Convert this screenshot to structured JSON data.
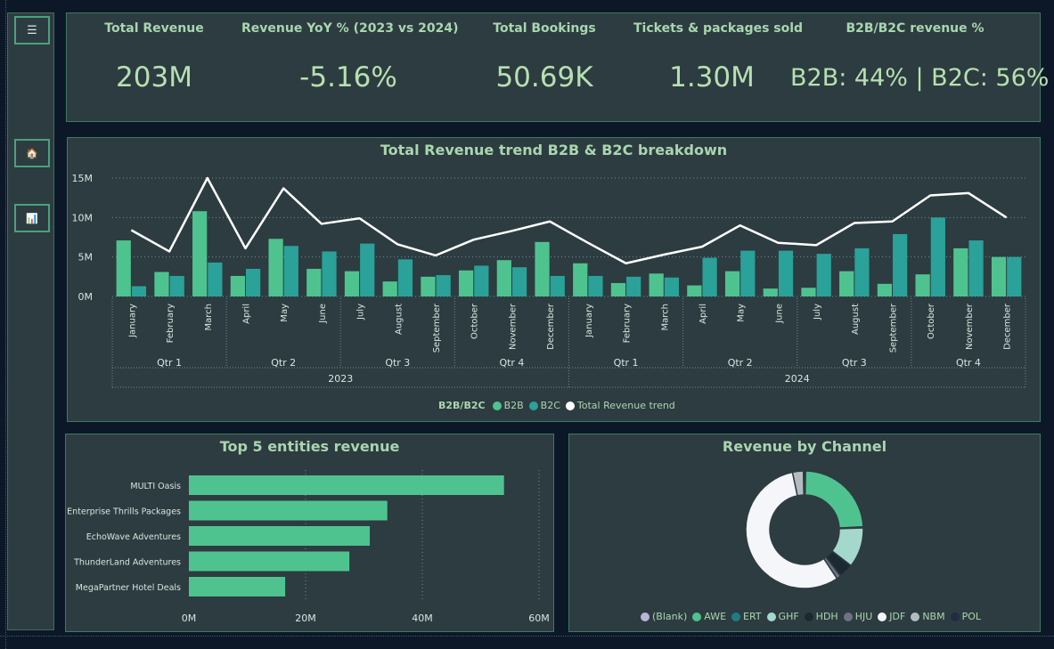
{
  "sidebar": {
    "buttons": [
      {
        "name": "menu-icon",
        "glyph": "☰"
      },
      {
        "name": "home-icon",
        "glyph": "🏠"
      },
      {
        "name": "chart-icon",
        "glyph": "📊"
      }
    ]
  },
  "kpis": [
    {
      "label": "Total Revenue",
      "value": "203M"
    },
    {
      "label": "Revenue YoY % (2023 vs 2024)",
      "value": "-5.16%"
    },
    {
      "label": "Total Bookings",
      "value": "50.69K"
    },
    {
      "label": "Tickets & packages sold",
      "value": "1.30M"
    },
    {
      "label": "B2B/B2C revenue %",
      "value": "B2B: 44% | B2C: 56%"
    }
  ],
  "colors": {
    "b2b": "#4fc38f",
    "b2c": "#2aa199",
    "trend": "#ffffff",
    "axis_text": "#d7e6e0",
    "title": "#a9d6af",
    "grid": "#6d8a93"
  },
  "chart_data": [
    {
      "type": "bar",
      "title": "Total Revenue trend B2B & B2C breakdown",
      "categories": [
        "January",
        "February",
        "March",
        "April",
        "May",
        "June",
        "July",
        "August",
        "September",
        "October",
        "November",
        "December",
        "January",
        "February",
        "March",
        "April",
        "May",
        "June",
        "July",
        "August",
        "September",
        "October",
        "November",
        "December"
      ],
      "quarters": [
        {
          "label": "Qtr 1"
        },
        {
          "label": "Qtr 2"
        },
        {
          "label": "Qtr 3"
        },
        {
          "label": "Qtr 4"
        },
        {
          "label": "Qtr 1"
        },
        {
          "label": "Qtr 2"
        },
        {
          "label": "Qtr 3"
        },
        {
          "label": "Qtr 4"
        }
      ],
      "years": [
        "2023",
        "2024"
      ],
      "yticks": [
        "0M",
        "5M",
        "10M",
        "15M"
      ],
      "ylim": [
        0,
        15
      ],
      "legend_title": "B2B/B2C",
      "series": [
        {
          "name": "B2B",
          "type": "bar",
          "values": [
            7.1,
            3.1,
            10.8,
            2.6,
            7.3,
            3.5,
            3.2,
            1.9,
            2.5,
            3.3,
            4.6,
            6.9,
            4.2,
            1.7,
            2.9,
            1.4,
            3.2,
            1.0,
            1.1,
            3.2,
            1.6,
            2.8,
            6.1,
            5.0
          ]
        },
        {
          "name": "B2C",
          "type": "bar",
          "values": [
            1.3,
            2.6,
            4.3,
            3.5,
            6.4,
            5.7,
            6.7,
            4.7,
            2.7,
            3.9,
            3.7,
            2.6,
            2.6,
            2.5,
            2.4,
            4.9,
            5.8,
            5.8,
            5.4,
            6.1,
            7.9,
            10.0,
            7.1,
            5.0
          ]
        },
        {
          "name": "Total Revenue trend",
          "type": "line",
          "values": [
            8.4,
            5.7,
            15.0,
            6.1,
            13.7,
            9.2,
            9.9,
            6.6,
            5.2,
            7.2,
            8.3,
            9.5,
            6.8,
            4.2,
            5.3,
            6.3,
            9.0,
            6.8,
            6.5,
            9.3,
            9.5,
            12.8,
            13.1,
            10.0
          ]
        }
      ]
    },
    {
      "type": "bar",
      "orientation": "horizontal",
      "title": "Top 5 entities revenue",
      "categories": [
        "MULTI Oasis",
        "Enterprise Thrills Packages",
        "EchoWave Adventures",
        "ThunderLand Adventures",
        "MegaPartner Hotel Deals"
      ],
      "values": [
        54,
        34,
        31,
        27.5,
        16.5
      ],
      "xticks": [
        "0M",
        "20M",
        "40M",
        "60M"
      ],
      "xlim": [
        0,
        60
      ]
    },
    {
      "type": "pie",
      "title": "Revenue by Channel",
      "slices": [
        {
          "name": "(Blank)",
          "value": 0.3,
          "color": "#b9b4d8"
        },
        {
          "name": "AWE",
          "value": 24.0,
          "color": "#4fc38f"
        },
        {
          "name": "ERT",
          "value": 0.3,
          "color": "#1e7d84"
        },
        {
          "name": "GHF",
          "value": 11.0,
          "color": "#a5d8cc"
        },
        {
          "name": "HDH",
          "value": 4.0,
          "color": "#1c2933"
        },
        {
          "name": "HJU",
          "value": 1.2,
          "color": "#6c7385"
        },
        {
          "name": "JDF",
          "value": 56.2,
          "color": "#f4f6fa"
        },
        {
          "name": "NBM",
          "value": 3.0,
          "color": "#b4bcc0"
        },
        {
          "name": "POL",
          "value": 0.3,
          "color": "#222a44"
        }
      ]
    }
  ]
}
